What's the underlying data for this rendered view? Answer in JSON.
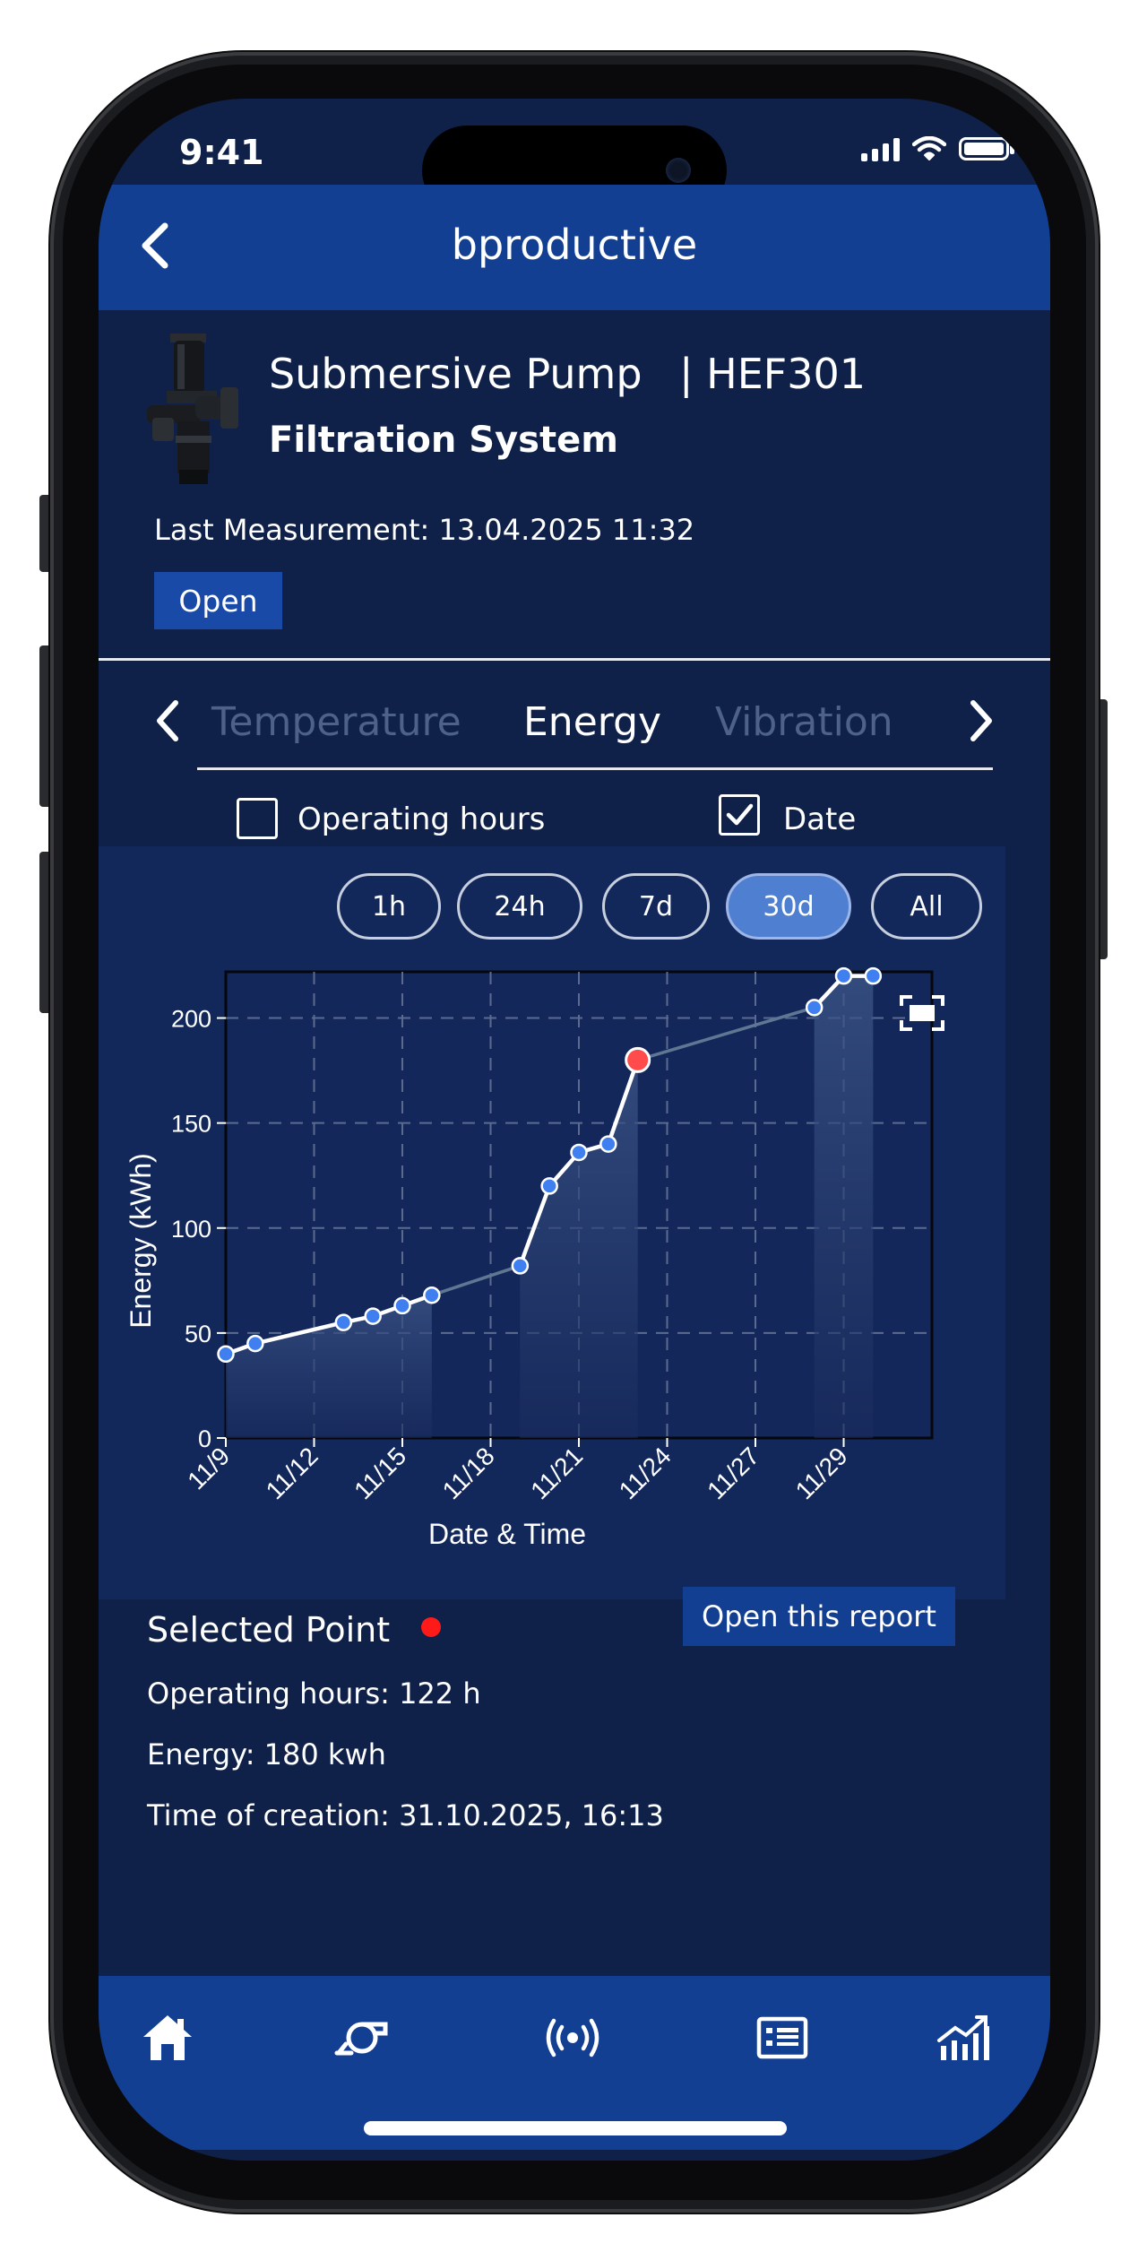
{
  "status_bar": {
    "time": "9:41"
  },
  "header": {
    "title": "bproductive",
    "back_icon": "chevron-left-icon"
  },
  "device": {
    "name": "Submersive Pump",
    "id": "| HEF301",
    "system": "Filtration System",
    "last_measurement": "Last Measurement: 13.04.2025 11:32",
    "open_label": "Open"
  },
  "tabs": {
    "items": [
      {
        "label": "Temperature",
        "active": false
      },
      {
        "label": "Energy",
        "active": true
      },
      {
        "label": "Vibration",
        "active": false
      }
    ]
  },
  "filters": {
    "operating_hours": {
      "label": "Operating hours",
      "checked": false
    },
    "date": {
      "label": "Date",
      "checked": true
    }
  },
  "time_ranges": {
    "items": [
      {
        "label": "1h",
        "selected": false
      },
      {
        "label": "24h",
        "selected": false
      },
      {
        "label": "7d",
        "selected": false
      },
      {
        "label": "30d",
        "selected": true
      },
      {
        "label": "All",
        "selected": false
      }
    ]
  },
  "chart_data": {
    "type": "line",
    "xlabel": "Date & Time",
    "ylabel": "Energy (kWh)",
    "ylim": [
      0,
      222
    ],
    "yticks": [
      0,
      50,
      100,
      150,
      200
    ],
    "xtick_labels": [
      "11/9",
      "11/12",
      "11/15",
      "11/18",
      "11/21",
      "11/24",
      "11/27",
      "11/29"
    ],
    "grid": true,
    "x_day_range": [
      9,
      33
    ],
    "x_tick_days": [
      9,
      12,
      15,
      18,
      21,
      24,
      27,
      30
    ],
    "points": [
      {
        "day": 9,
        "value": 40
      },
      {
        "day": 10,
        "value": 45
      },
      {
        "day": 13,
        "value": 55
      },
      {
        "day": 14,
        "value": 58
      },
      {
        "day": 15,
        "value": 63
      },
      {
        "day": 16,
        "value": 68
      },
      {
        "day": 19,
        "value": 82
      },
      {
        "day": 20,
        "value": 120
      },
      {
        "day": 21,
        "value": 136
      },
      {
        "day": 22,
        "value": 140
      },
      {
        "day": 23,
        "value": 180,
        "selected": true
      },
      {
        "day": 29,
        "value": 205
      },
      {
        "day": 30,
        "value": 220
      },
      {
        "day": 31,
        "value": 220
      }
    ],
    "colors": {
      "line": "#ffffff",
      "point": "#3f7ff0",
      "selected_point": "#ff4b4b",
      "muted_line": "#5f7793"
    }
  },
  "selected_point": {
    "title": "Selected Point",
    "report_label": "Open this report",
    "operating_hours": "Operating hours: 122 h",
    "energy": "Energy: 180 kwh",
    "time_of_creation": "Time of creation: 31.10.2025, 16:13"
  },
  "bottom_nav": {
    "items": [
      "home-icon",
      "pump-icon",
      "broadcast-icon",
      "report-list-icon",
      "analytics-icon"
    ]
  }
}
